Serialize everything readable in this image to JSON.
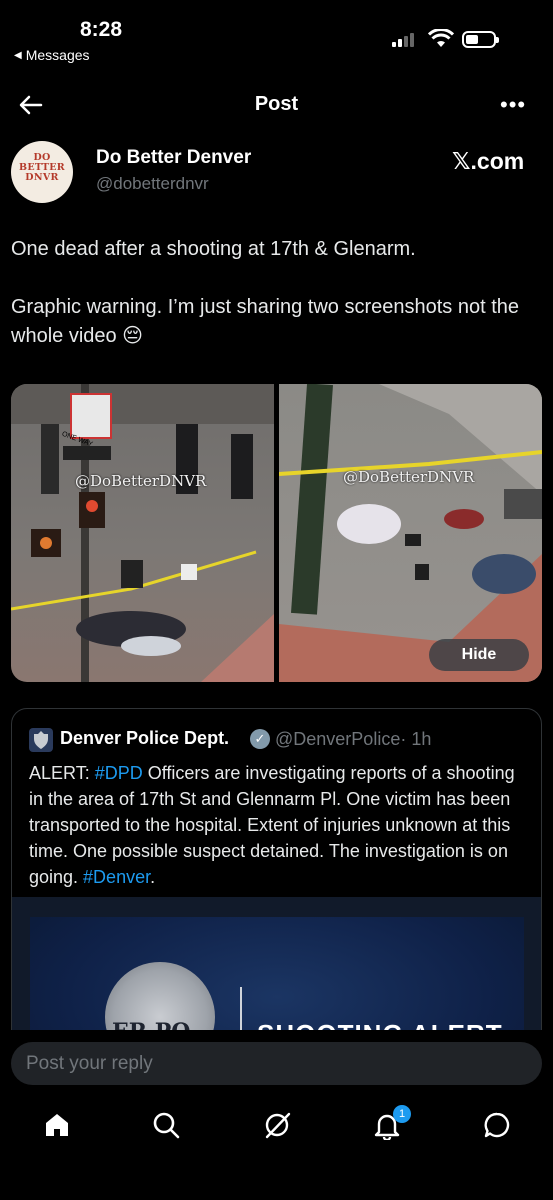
{
  "status_bar": {
    "time": "8:28",
    "back_app": "Messages"
  },
  "header": {
    "title": "Post"
  },
  "author": {
    "logo_text": [
      "DO",
      "BETTER",
      "DNVR"
    ],
    "display_name": "Do Better Denver",
    "handle": "@dobetterdnvr",
    "site": "𝕏.com"
  },
  "post": {
    "paragraphs": [
      "One dead after a shooting at 17th & Glenarm.",
      "Graphic warning. I’m just sharing two screenshots not the whole video 😔"
    ],
    "watermark": "@DoBetterDNVR",
    "hide_label": "Hide",
    "sign_text": "ONE WAY"
  },
  "quote": {
    "name": "Denver Police Dept.",
    "handle": "@DenverPolice",
    "time": "· 1h",
    "text_parts": {
      "a": "ALERT: ",
      "tag1": "#DPD",
      "b": " Officers are investigating reports of a shooting in the area of 17th St and Glennarm Pl.  One victim has been transported to the hospital. Extent of injuries unknown at this time. One possible suspect detained. The investigation is on going. ",
      "tag2": "#Denver",
      "c": "."
    },
    "image_badge": "ER PO",
    "image_title": "SHOOTING ALERT"
  },
  "reply": {
    "placeholder": "Post your reply"
  },
  "nav": {
    "notifications_count": "1"
  },
  "colors": {
    "accent": "#1d9bf0",
    "muted": "#71767b",
    "background": "#000000"
  }
}
